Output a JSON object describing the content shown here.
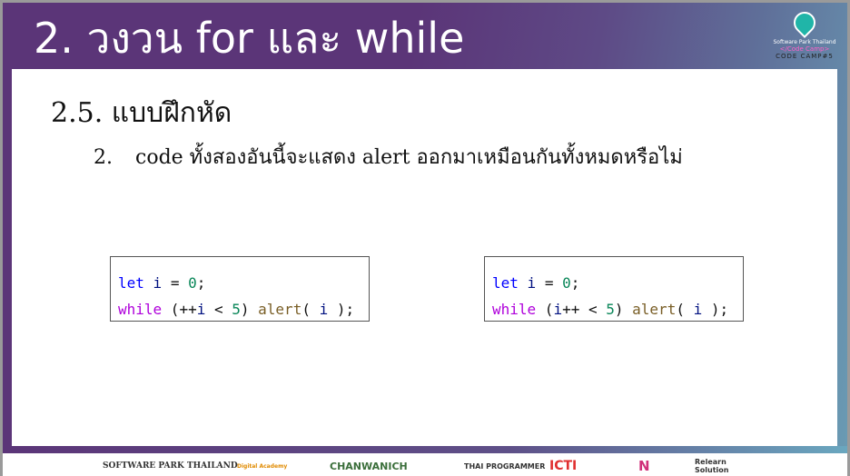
{
  "slide": {
    "title": "2. วงวน for และ while",
    "heading": "2.5.  แบบฝึกหัด",
    "question_number": "2.",
    "question_text": "code ทั้งสองอันนี้จะแสดง alert ออกมาเหมือนกันทั้งหมดหรือไม่",
    "code_left": {
      "line1": [
        "let",
        " i ",
        "= ",
        "0",
        ";"
      ],
      "line2": [
        "while",
        " (++",
        "i",
        " < ",
        "5",
        ") ",
        "alert",
        "( ",
        "i",
        " );"
      ]
    },
    "code_right": {
      "line1": [
        "let",
        " i ",
        "= ",
        "0",
        ";"
      ],
      "line2": [
        "while",
        " (",
        "i",
        "++ < ",
        "5",
        ") ",
        "alert",
        "( ",
        "i",
        " );"
      ]
    }
  },
  "logo": {
    "line1": "Software Park Thailand",
    "line2": "</Code Camp>",
    "line3": "CODE CAMP#5"
  },
  "sponsors": [
    "SOFTWARE PARK THAILAND",
    "Digital Academy",
    "CHANWANICH",
    "THAI PROGRAMMER",
    "ICTI",
    "N",
    "Relearn Solution"
  ],
  "colors": {
    "purple": "#5b3578",
    "keyword": "#0000ff",
    "control": "#af00db",
    "number": "#098658",
    "function": "#795e26",
    "identifier": "#001080"
  }
}
